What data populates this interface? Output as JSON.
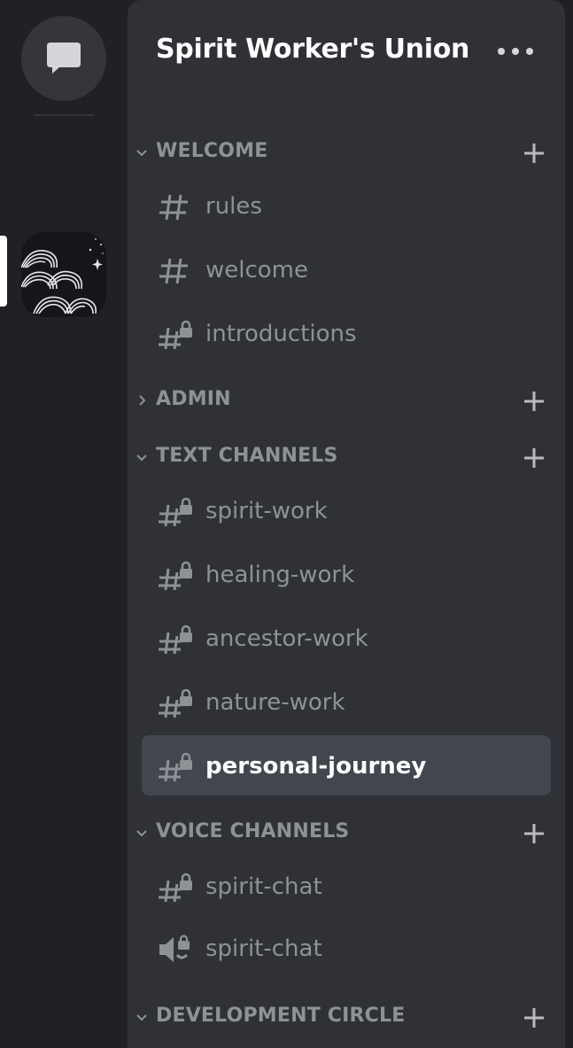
{
  "server": {
    "name": "Spirit Worker's Union"
  },
  "rail": {
    "dm_icon": "chat-bubble-icon",
    "server_icon": "wave-art-server-icon"
  },
  "colors": {
    "rail_bg": "#1f2125",
    "panel_bg": "#2f3136",
    "muted_text": "#8e9297",
    "active_bg": "#42464e",
    "active_text": "#ffffff"
  },
  "categories": {
    "welcome": {
      "label": "WELCOME",
      "expanded": true
    },
    "admin": {
      "label": "ADMIN",
      "expanded": false
    },
    "text_channels": {
      "label": "TEXT CHANNELS",
      "expanded": true
    },
    "voice_channels": {
      "label": "VOICE CHANNELS",
      "expanded": true
    },
    "development_circle": {
      "label": "DEVELOPMENT CIRCLE",
      "expanded": true
    }
  },
  "channels": {
    "rules": {
      "label": "rules",
      "icon": "hash-icon"
    },
    "welcome": {
      "label": "welcome",
      "icon": "hash-icon"
    },
    "introductions": {
      "label": "introductions",
      "icon": "hash-lock-icon"
    },
    "spirit_work": {
      "label": "spirit-work",
      "icon": "hash-lock-icon"
    },
    "healing_work": {
      "label": "healing-work",
      "icon": "hash-lock-icon"
    },
    "ancestor_work": {
      "label": "ancestor-work",
      "icon": "hash-lock-icon"
    },
    "nature_work": {
      "label": "nature-work",
      "icon": "hash-lock-icon"
    },
    "personal_journey": {
      "label": "personal-journey",
      "icon": "hash-lock-icon",
      "selected": true
    },
    "spirit_chat_text": {
      "label": "spirit-chat",
      "icon": "hash-lock-icon"
    },
    "spirit_chat_voice": {
      "label": "spirit-chat",
      "icon": "speaker-lock-icon"
    }
  }
}
